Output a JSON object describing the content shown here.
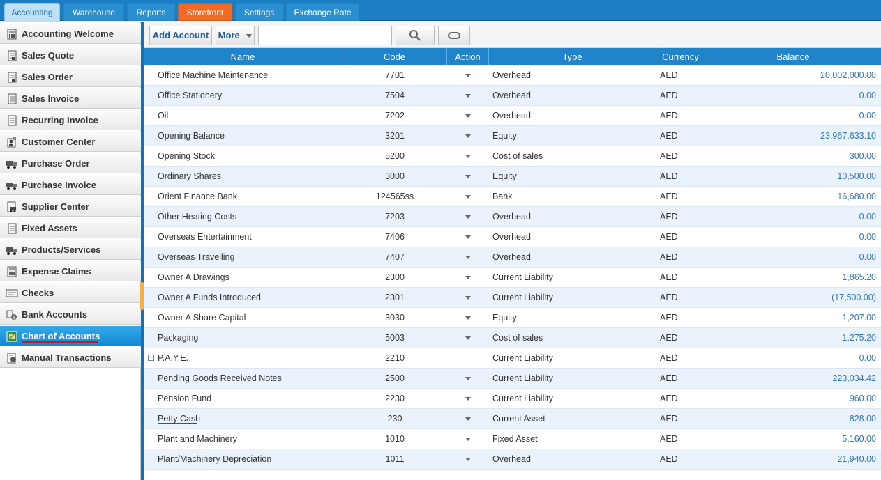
{
  "top_tabs": [
    {
      "label": "Accounting",
      "state": "active"
    },
    {
      "label": "Warehouse",
      "state": "normal"
    },
    {
      "label": "Reports",
      "state": "normal"
    },
    {
      "label": "Storefront",
      "state": "highlight"
    },
    {
      "label": "Settings",
      "state": "normal"
    },
    {
      "label": "Exchange Rate",
      "state": "normal"
    }
  ],
  "sidebar": {
    "items": [
      {
        "label": "Accounting Welcome",
        "icon": "calculator-icon"
      },
      {
        "label": "Sales Quote",
        "icon": "document-icon"
      },
      {
        "label": "Sales Order",
        "icon": "document-icon"
      },
      {
        "label": "Sales Invoice",
        "icon": "document-icon"
      },
      {
        "label": "Recurring Invoice",
        "icon": "document-icon"
      },
      {
        "label": "Customer Center",
        "icon": "customer-icon"
      },
      {
        "label": "Purchase Order",
        "icon": "truck-icon"
      },
      {
        "label": "Purchase Invoice",
        "icon": "truck-icon"
      },
      {
        "label": "Supplier Center",
        "icon": "supplier-icon"
      },
      {
        "label": "Fixed Assets",
        "icon": "document-icon"
      },
      {
        "label": "Products/Services",
        "icon": "truck-icon"
      },
      {
        "label": "Expense Claims",
        "icon": "calculator-icon"
      },
      {
        "label": "Checks",
        "icon": "check-icon"
      },
      {
        "label": "Bank Accounts",
        "icon": "bank-icon"
      },
      {
        "label": "Chart of Accounts",
        "icon": "chart-of-accounts-icon",
        "active": true
      },
      {
        "label": "Manual Transactions",
        "icon": "transactions-icon"
      }
    ]
  },
  "toolbar": {
    "add_account_label": "Add Account",
    "more_label": "More",
    "search_value": "",
    "search_icon": "magnifier-icon",
    "refresh_icon": "refresh-icon"
  },
  "grid": {
    "columns": [
      "Name",
      "Code",
      "Action",
      "Type",
      "Currency",
      "Balance"
    ],
    "rows": [
      {
        "name": "Office Machine Maintenance",
        "code": "7701",
        "type": "Overhead",
        "currency": "AED",
        "balance": "20,002,000.00"
      },
      {
        "name": "Office Stationery",
        "code": "7504",
        "type": "Overhead",
        "currency": "AED",
        "balance": "0.00"
      },
      {
        "name": "Oil",
        "code": "7202",
        "type": "Overhead",
        "currency": "AED",
        "balance": "0.00"
      },
      {
        "name": "Opening Balance",
        "code": "3201",
        "type": "Equity",
        "currency": "AED",
        "balance": "23,967,633.10"
      },
      {
        "name": "Opening Stock",
        "code": "5200",
        "type": "Cost of sales",
        "currency": "AED",
        "balance": "300.00"
      },
      {
        "name": "Ordinary Shares",
        "code": "3000",
        "type": "Equity",
        "currency": "AED",
        "balance": "10,500.00"
      },
      {
        "name": "Orient Finance Bank",
        "code": "124565ss",
        "type": "Bank",
        "currency": "AED",
        "balance": "16,680.00"
      },
      {
        "name": "Other Heating Costs",
        "code": "7203",
        "type": "Overhead",
        "currency": "AED",
        "balance": "0.00"
      },
      {
        "name": "Overseas Entertainment",
        "code": "7406",
        "type": "Overhead",
        "currency": "AED",
        "balance": "0.00"
      },
      {
        "name": "Overseas Travelling",
        "code": "7407",
        "type": "Overhead",
        "currency": "AED",
        "balance": "0.00"
      },
      {
        "name": "Owner A Drawings",
        "code": "2300",
        "type": "Current Liability",
        "currency": "AED",
        "balance": "1,865.20"
      },
      {
        "name": "Owner A Funds Introduced",
        "code": "2301",
        "type": "Current Liability",
        "currency": "AED",
        "balance": "(17,500.00)"
      },
      {
        "name": "Owner A Share Capital",
        "code": "3030",
        "type": "Equity",
        "currency": "AED",
        "balance": "1,207.00"
      },
      {
        "name": "Packaging",
        "code": "5003",
        "type": "Cost of sales",
        "currency": "AED",
        "balance": "1,275.20"
      },
      {
        "name": "P.A.Y.E.",
        "code": "2210",
        "type": "Current Liability",
        "currency": "AED",
        "balance": "0.00",
        "expandable": true,
        "no_action": true
      },
      {
        "name": "Pending Goods Received Notes",
        "code": "2500",
        "type": "Current Liability",
        "currency": "AED",
        "balance": "223,034.42"
      },
      {
        "name": "Pension Fund",
        "code": "2230",
        "type": "Current Liability",
        "currency": "AED",
        "balance": "960.00"
      },
      {
        "name": "Petty Cash",
        "code": "230",
        "type": "Current Asset",
        "currency": "AED",
        "balance": "828.00",
        "underlined": true
      },
      {
        "name": "Plant and Machinery",
        "code": "1010",
        "type": "Fixed Asset",
        "currency": "AED",
        "balance": "5,160.00"
      },
      {
        "name": "Plant/Machinery Depreciation",
        "code": "1011",
        "type": "Overhead",
        "currency": "AED",
        "balance": "21,940.00"
      }
    ]
  },
  "colors": {
    "accent": "#1b7ec2",
    "highlight_tab": "#f06a26",
    "balance_text": "#2f79b9",
    "annotation_underline": "#e01010"
  }
}
